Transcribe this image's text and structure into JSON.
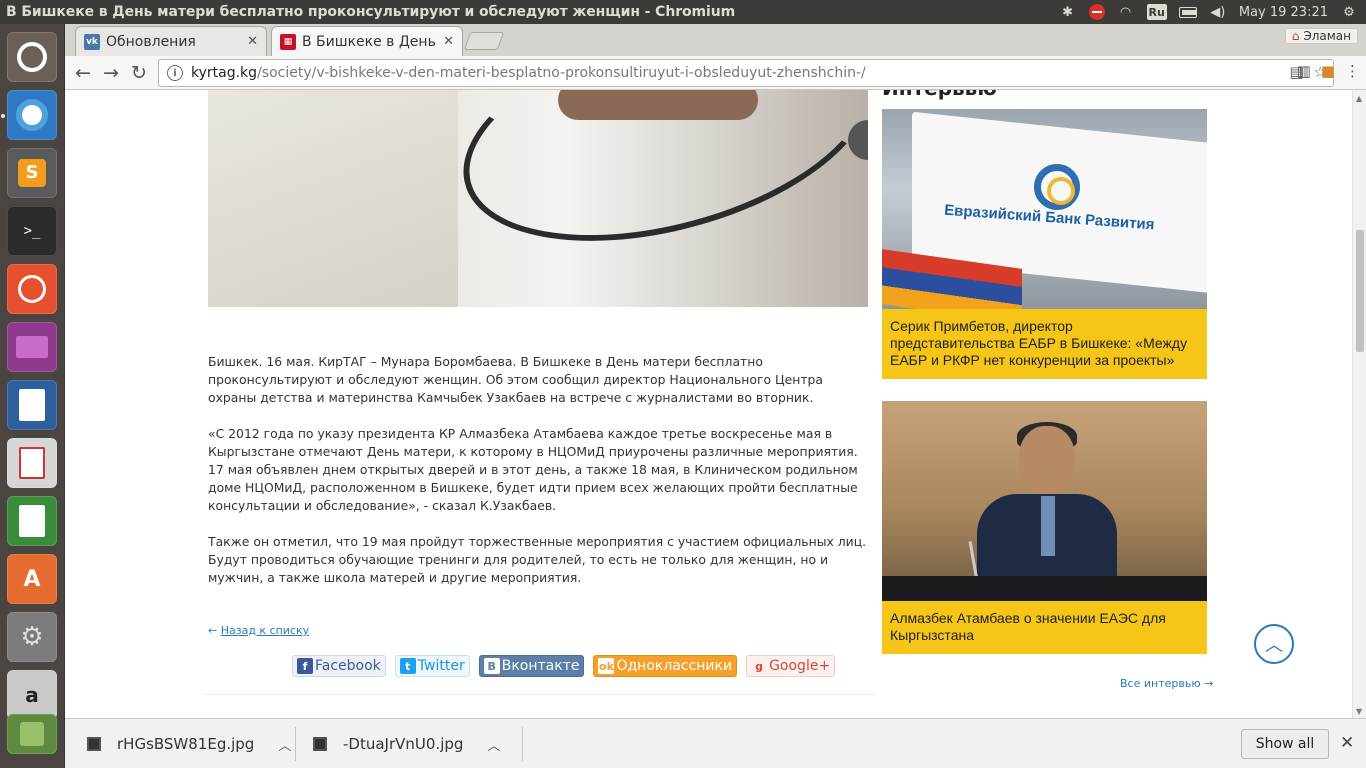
{
  "window": {
    "title": "В Бишкеке в День матери бесплатно проконсультируют и обследуют женщин - Chromium"
  },
  "tray": {
    "lang": "Ru",
    "clock": "May 19 23:21"
  },
  "tabs": [
    {
      "label": "Обновления",
      "favicon": "vk-icon",
      "color": "#4a76a8",
      "active": false
    },
    {
      "label": "В Бишкеке в День м",
      "favicon": "kyrtag-icon",
      "color": "#c8102e",
      "active": true
    }
  ],
  "profile": {
    "name": "Эламан"
  },
  "address": {
    "host": "kyrtag.kg",
    "path": "/society/v-bishkeke-v-den-materi-besplatno-prokonsultiruyut-i-obsleduyut-zhenshchin-/"
  },
  "article": {
    "paragraphs": [
      "Бишкек. 16 мая. КирТАГ – Мунара Боромбаева. В Бишкеке в День матери бесплатно проконсультируют и обследуют женщин. Об этом сообщил директор Национального Центра охраны детства и материнства Камчыбек Узакбаев на встрече с журналистами во вторник.",
      "«С 2012 года по указу президента КР Алмазбека Атамбаева каждое третье воскресенье мая в Кыргызстане отмечают День матери, к которому в НЦОМиД приурочены различные мероприятия. 17 мая объявлен днем открытых дверей и в этот день, а также 18 мая, в Клиническом родильном доме НЦОМиД, расположенном в Бишкеке, будет идти прием всех желающих пройти бесплатные консультации и обследование», - сказал К.Узакбаев.",
      "Также он отметил, что 19 мая пройдут торжественные мероприятия с участием официальных лиц. Будут проводиться обучающие тренинги для родителей, то есть не только для женщин, но и мужчин, а также школа матерей и другие мероприятия."
    ],
    "back_arrow": "←",
    "back_link": "Назад к списку"
  },
  "share": {
    "facebook": "Facebook",
    "twitter": "Twitter",
    "vkontakte": "Вконтакте",
    "odnoklassniki": "Одноклассники",
    "googleplus": "Google+"
  },
  "sidebar": {
    "heading": "Интервью",
    "cards": [
      {
        "caption": "Серик Примбетов, директор представительства ЕАБР в Бишкеке: «Между ЕАБР и РКФР нет конкуренции за проекты»",
        "image_text": "Евразийский Банк Развития"
      },
      {
        "caption": "Алмазбек Атамбаев о значении ЕАЭС для Кыргызстана"
      }
    ],
    "all_link": "Все интервью →"
  },
  "downloads": {
    "items": [
      {
        "name": "rHGsBSW81Eg.jpg"
      },
      {
        "name": "-DtuaJrVnU0.jpg"
      }
    ],
    "show_all": "Show all"
  }
}
